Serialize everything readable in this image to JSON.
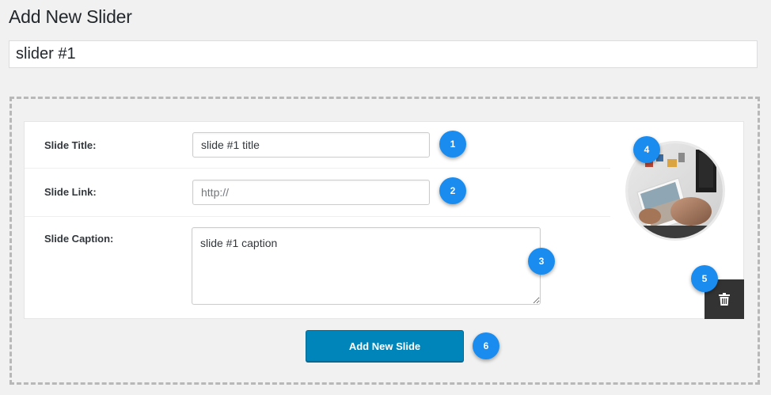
{
  "page": {
    "title": "Add New Slider"
  },
  "slider": {
    "name": "slider #1"
  },
  "slide": {
    "title_label": "Slide Title:",
    "title_value": "slide #1 title",
    "link_label": "Slide Link:",
    "link_value": "",
    "link_placeholder": "http://",
    "caption_label": "Slide Caption:",
    "caption_value": "slide #1 caption",
    "image_icon": "photo-thumbnail",
    "delete_icon": "trash-icon"
  },
  "badges": {
    "b1": "1",
    "b2": "2",
    "b3": "3",
    "b4": "4",
    "b5": "5",
    "b6": "6"
  },
  "actions": {
    "add_slide_label": "Add New Slide"
  },
  "colors": {
    "badge": "#1a8cf0",
    "primary_button": "#0085ba",
    "delete_button": "#333333",
    "background": "#f1f1f1"
  }
}
